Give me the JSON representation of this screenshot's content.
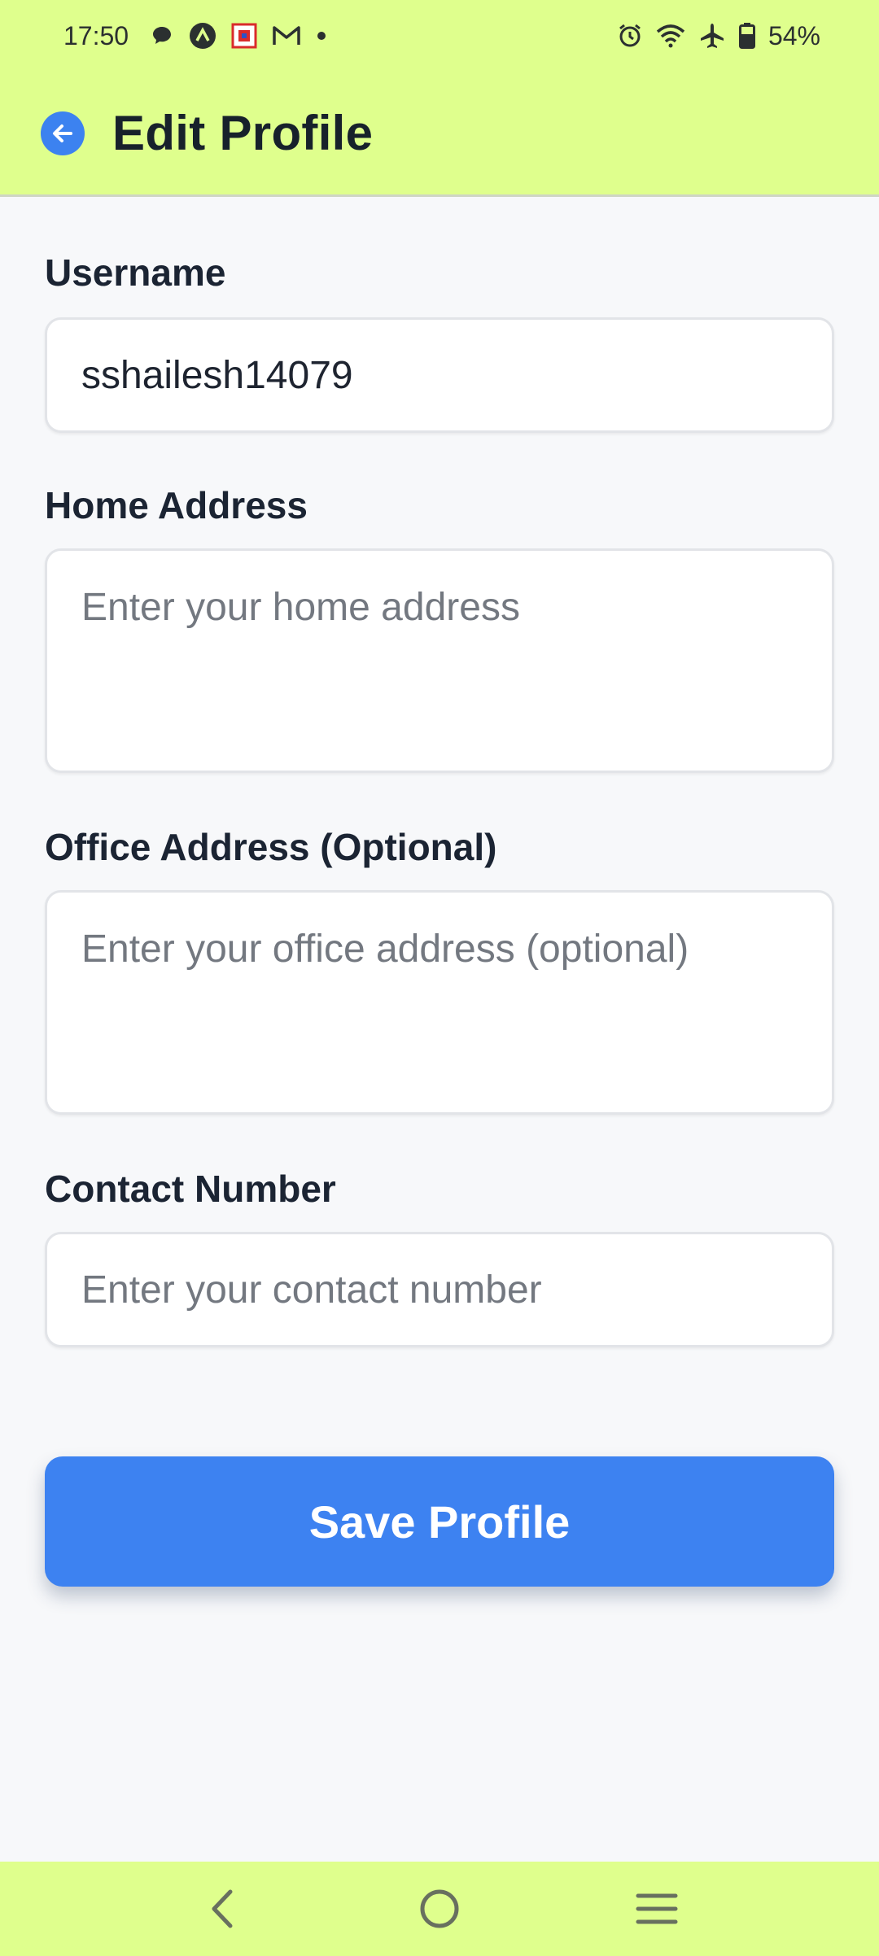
{
  "status_bar": {
    "time": "17:50",
    "battery_text": "54%",
    "left_icons": [
      "chat-bubble-icon",
      "arrow-up-circle-icon",
      "red-square-app-icon",
      "gmail-icon",
      "dot-icon"
    ],
    "right_icons": [
      "alarm-icon",
      "wifi-icon",
      "airplane-icon",
      "battery-icon"
    ]
  },
  "app_bar": {
    "title": "Edit Profile",
    "back_icon": "arrow-left-icon"
  },
  "form": {
    "username": {
      "label": "Username",
      "value": "sshailesh14079"
    },
    "home_address": {
      "label": "Home Address",
      "placeholder": "Enter your home address"
    },
    "office_address": {
      "label": "Office Address (Optional)",
      "placeholder": "Enter your office address (optional)"
    },
    "contact_number": {
      "label": "Contact Number",
      "placeholder": "Enter your contact number"
    }
  },
  "save_button": {
    "label": "Save Profile"
  },
  "nav_bar": {
    "icons": [
      "back-chevron-icon",
      "home-circle-icon",
      "recents-menu-icon"
    ]
  },
  "colors": {
    "bar_background": "#dfff8d",
    "accent": "#3d82f1",
    "page_background": "#f7f8fa"
  }
}
